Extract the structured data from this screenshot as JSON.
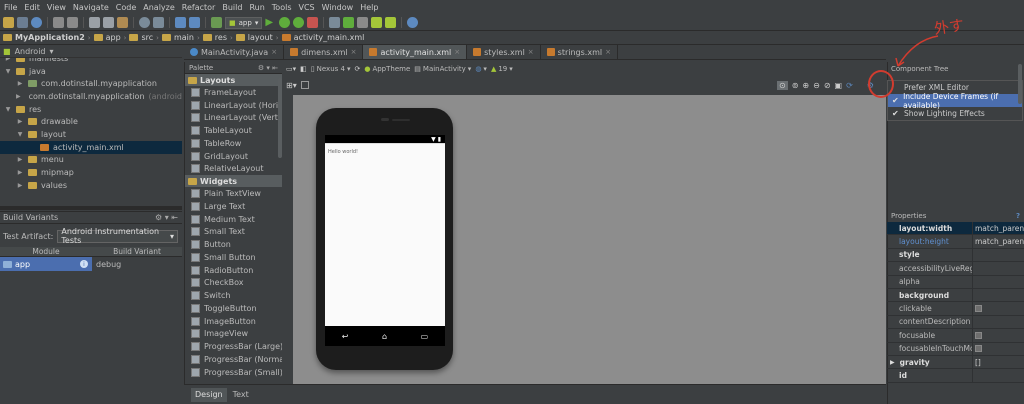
{
  "menu": [
    "File",
    "Edit",
    "View",
    "Navigate",
    "Code",
    "Analyze",
    "Refactor",
    "Build",
    "Run",
    "Tools",
    "VCS",
    "Window",
    "Help"
  ],
  "toolbar": {
    "app_config": "app"
  },
  "breadcrumbs": [
    "MyApplication2",
    "app",
    "src",
    "main",
    "res",
    "layout",
    "activity_main.xml"
  ],
  "project": {
    "view_mode": "Android",
    "items": [
      {
        "label": "manifests",
        "indent": 1,
        "type": "folder"
      },
      {
        "label": "java",
        "indent": 1,
        "type": "folder",
        "expanded": true
      },
      {
        "label": "com.dotinstall.myapplication",
        "indent": 2,
        "type": "package"
      },
      {
        "label": "com.dotinstall.myapplication",
        "suffix": "(androidTest)",
        "indent": 2,
        "type": "package"
      },
      {
        "label": "res",
        "indent": 1,
        "type": "folder",
        "expanded": true
      },
      {
        "label": "drawable",
        "indent": 2,
        "type": "folder"
      },
      {
        "label": "layout",
        "indent": 2,
        "type": "folder",
        "expanded": true
      },
      {
        "label": "activity_main.xml",
        "indent": 3,
        "type": "file",
        "selected": true
      },
      {
        "label": "menu",
        "indent": 2,
        "type": "folder"
      },
      {
        "label": "mipmap",
        "indent": 2,
        "type": "folder"
      },
      {
        "label": "values",
        "indent": 2,
        "type": "folder"
      }
    ]
  },
  "build_variants": {
    "title": "Build Variants",
    "test_artifact_label": "Test Artifact:",
    "test_artifact_value": "Android Instrumentation Tests",
    "col_module": "Module",
    "col_variant": "Build Variant",
    "row_module": "app",
    "row_variant": "debug"
  },
  "editor_tabs": [
    {
      "label": "MainActivity.java",
      "color": "#4a89c8"
    },
    {
      "label": "dimens.xml",
      "color": "#c77a2e"
    },
    {
      "label": "activity_main.xml",
      "color": "#c77a2e",
      "active": true
    },
    {
      "label": "styles.xml",
      "color": "#c77a2e"
    },
    {
      "label": "strings.xml",
      "color": "#c77a2e"
    }
  ],
  "palette": {
    "title": "Palette",
    "sections": [
      {
        "name": "Layouts",
        "items": [
          "FrameLayout",
          "LinearLayout (Horizontal)",
          "LinearLayout (Vertical)",
          "TableLayout",
          "TableRow",
          "GridLayout",
          "RelativeLayout"
        ]
      },
      {
        "name": "Widgets",
        "items": [
          "Plain TextView",
          "Large Text",
          "Medium Text",
          "Small Text",
          "Button",
          "Small Button",
          "RadioButton",
          "CheckBox",
          "Switch",
          "ToggleButton",
          "ImageButton",
          "ImageView",
          "ProgressBar (Large)",
          "ProgressBar (Normal)",
          "ProgressBar (Small)"
        ]
      }
    ]
  },
  "design_toolbar": {
    "device": "Nexus 4",
    "theme": "AppTheme",
    "activity": "MainActivity",
    "api": "19"
  },
  "preview": {
    "hello": "Hello world!"
  },
  "bottom_tabs": [
    "Design",
    "Text"
  ],
  "component_tree": {
    "title": "Component Tree",
    "menu": [
      {
        "label": "Prefer XML Editor",
        "checked": false
      },
      {
        "label": "Include Device Frames (if available)",
        "checked": true,
        "highlighted": true
      },
      {
        "label": "Show Lighting Effects",
        "checked": true
      }
    ]
  },
  "properties": {
    "title": "Properties",
    "rows": [
      {
        "key": "layout:width",
        "value": "match_parent",
        "style": "bold",
        "selected": true
      },
      {
        "key": "layout:height",
        "value": "match_parent",
        "style": "blue"
      },
      {
        "key": "style",
        "value": "",
        "style": "bold"
      },
      {
        "key": "accessibilityLiveRegion",
        "value": ""
      },
      {
        "key": "alpha",
        "value": ""
      },
      {
        "key": "background",
        "value": "",
        "style": "bold"
      },
      {
        "key": "clickable",
        "value": "",
        "checkbox": true
      },
      {
        "key": "contentDescription",
        "value": ""
      },
      {
        "key": "focusable",
        "value": "",
        "checkbox": true
      },
      {
        "key": "focusableInTouchMode",
        "value": "",
        "checkbox": true
      },
      {
        "key": "gravity",
        "value": "[]",
        "style": "bold",
        "expand": true
      },
      {
        "key": "id",
        "value": "",
        "style": "bold"
      }
    ]
  },
  "annotation": {
    "text": "外す"
  }
}
